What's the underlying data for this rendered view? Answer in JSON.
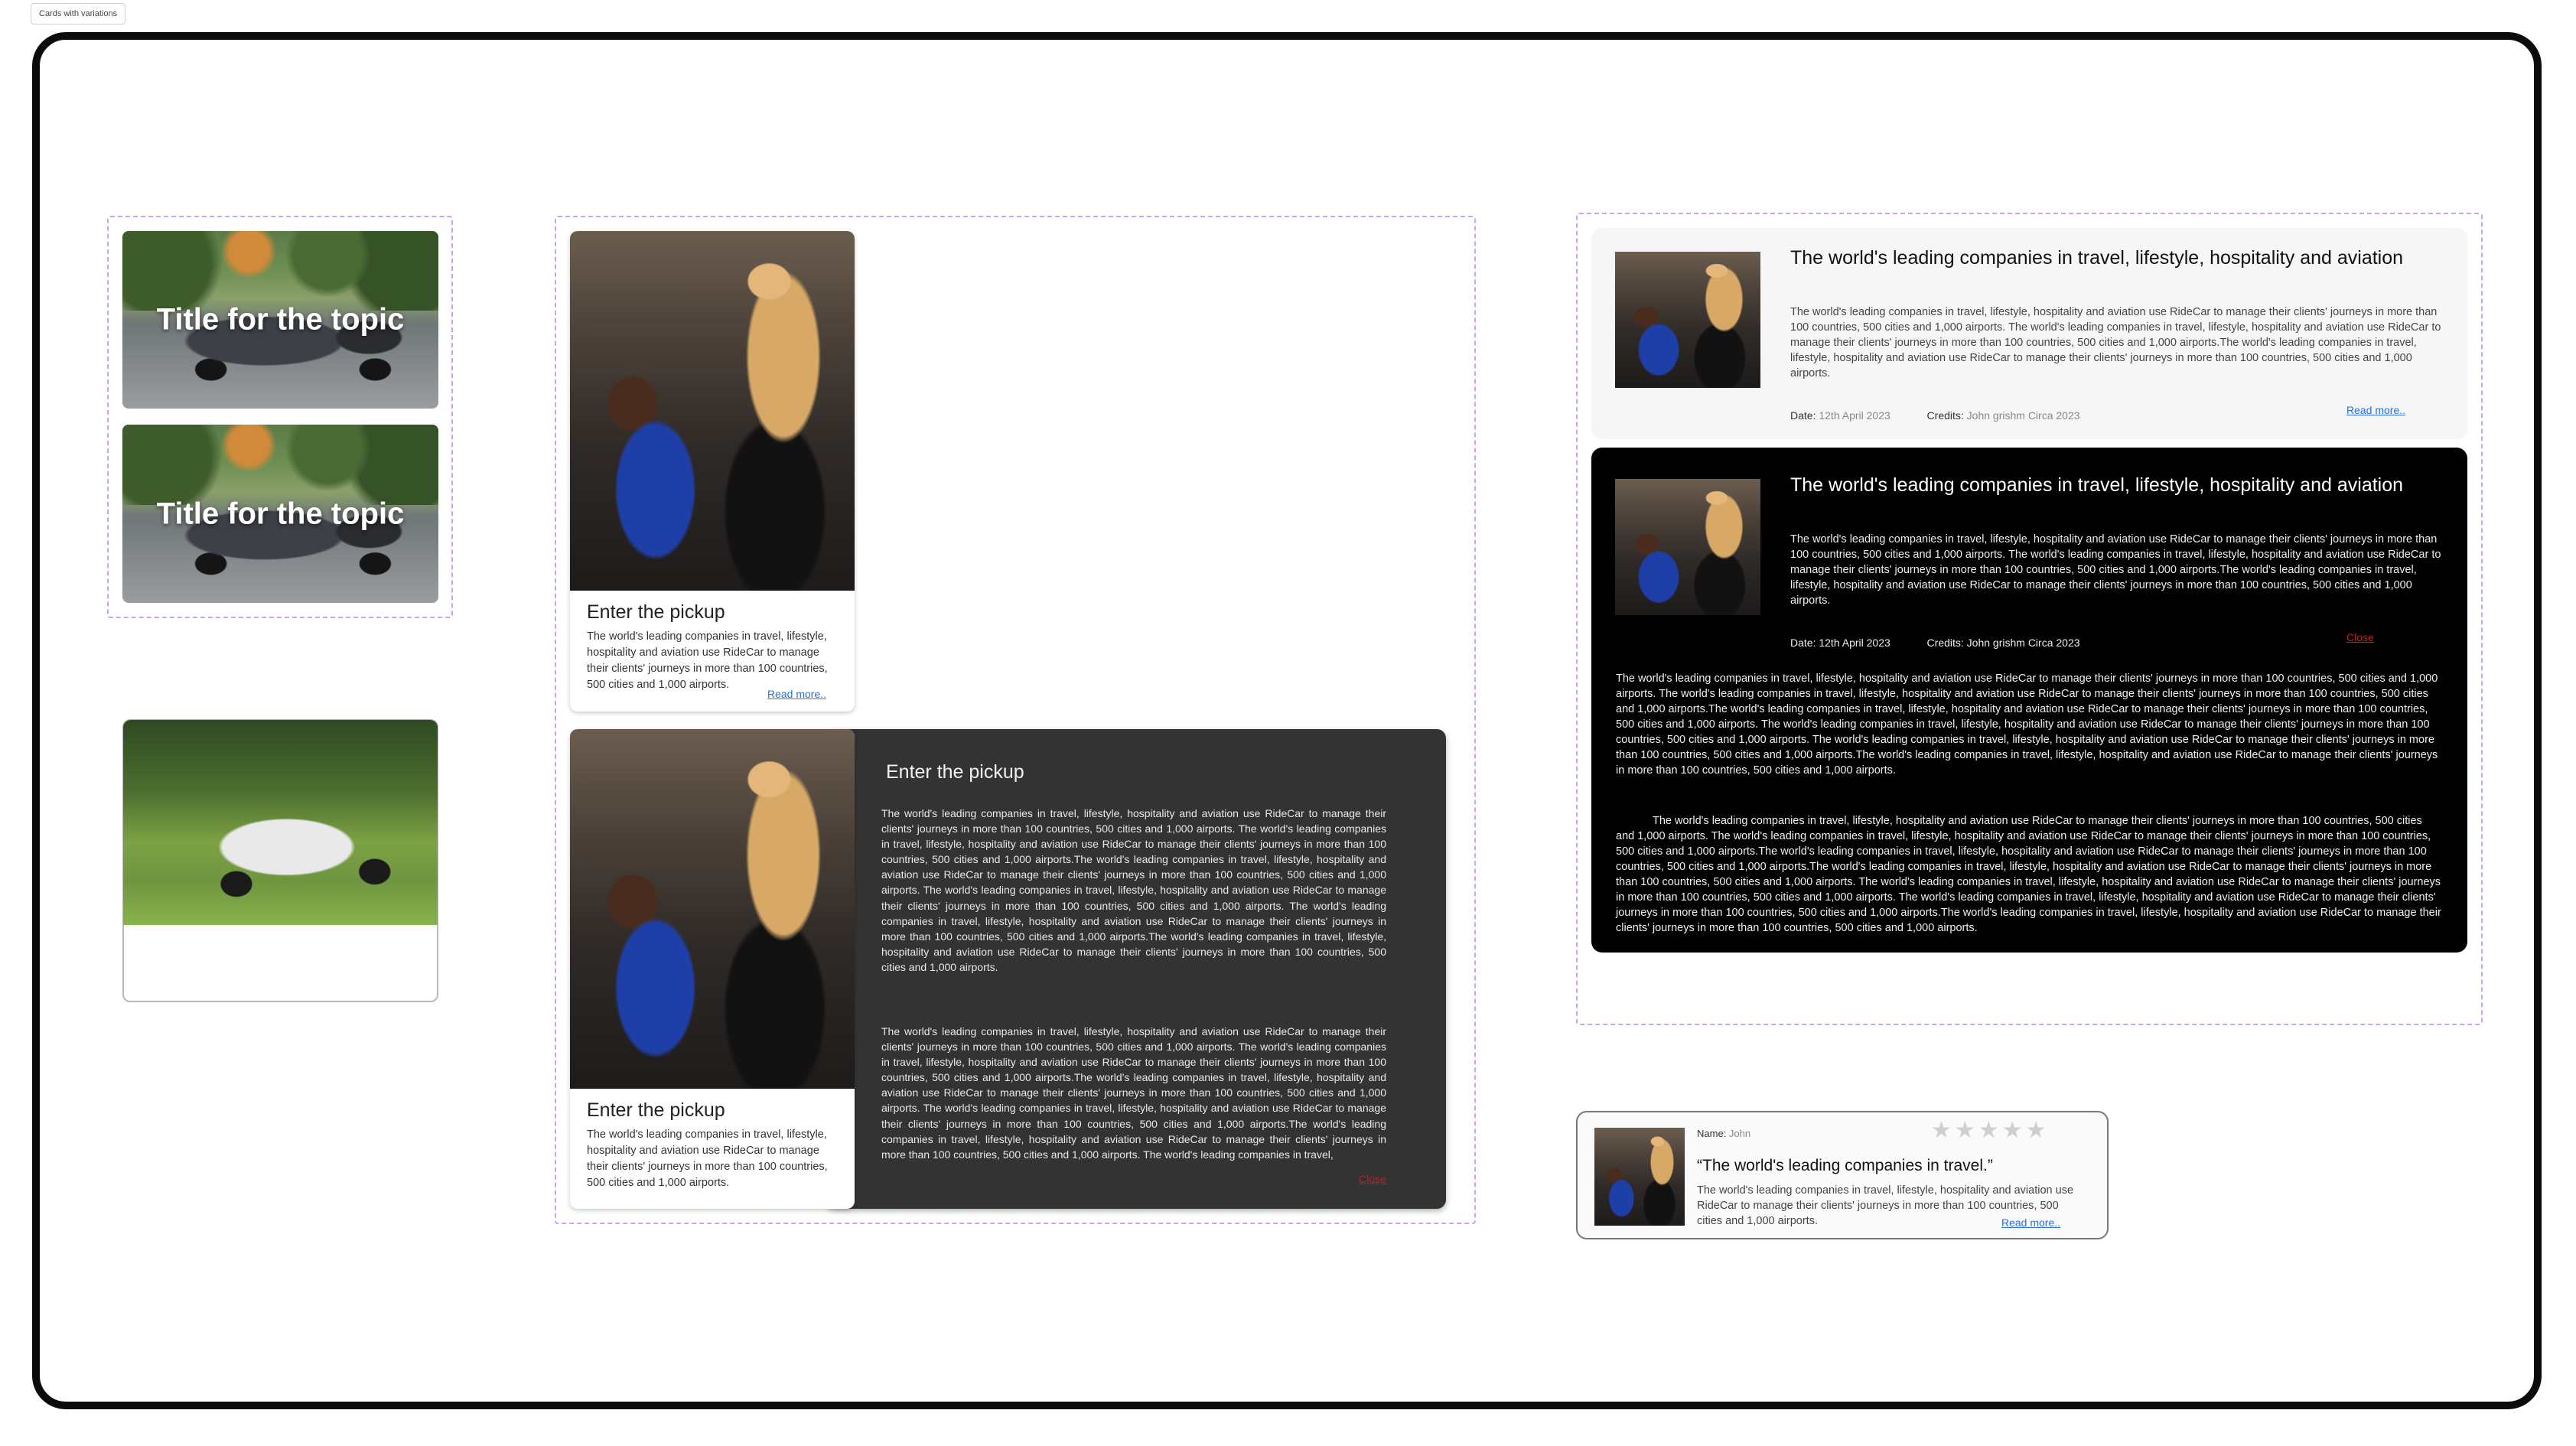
{
  "page_tag": "Cards with variations",
  "image_cards": [
    {
      "title": "Title for the topic"
    },
    {
      "title": "Title for the topic"
    }
  ],
  "pickup_card": {
    "title": "Enter the pickup",
    "body": "The world's leading companies in travel, lifestyle, hospitality and aviation use RideCar to manage their clients' journeys in more than 100 countries, 500 cities and 1,000 airports.",
    "read_more": "Read more.."
  },
  "pickup_card_expanded": {
    "title": "Enter the pickup",
    "body": "The world's leading companies in travel, lifestyle, hospitality and aviation use RideCar to manage their clients' journeys in more than 100 countries, 500 cities and 1,000 airports.",
    "panel_title": "Enter the pickup",
    "panel_para1": "The world's leading companies in travel, lifestyle, hospitality and aviation use RideCar to manage their clients' journeys in more than 100 countries, 500 cities and 1,000 airports. The world's leading companies in travel, lifestyle, hospitality and aviation use RideCar to manage their clients' journeys in more than 100 countries, 500 cities and 1,000 airports.The world's leading companies in travel, lifestyle, hospitality and aviation use RideCar to manage their clients' journeys in more than 100 countries, 500 cities and 1,000 airports. The world's leading companies in travel, lifestyle, hospitality and aviation use RideCar to manage their clients' journeys in more than 100 countries, 500 cities and 1,000 airports. The world's leading companies in travel, lifestyle, hospitality and aviation use RideCar to manage their clients' journeys in more than 100 countries, 500 cities and 1,000 airports.The world's leading companies in travel, lifestyle, hospitality and aviation use RideCar to manage their clients' journeys in more than 100 countries, 500 cities and 1,000 airports.",
    "panel_para2": "The world's leading companies in travel, lifestyle, hospitality and aviation use RideCar to manage their clients' journeys in more than 100 countries, 500 cities and 1,000 airports. The world's leading companies in travel, lifestyle, hospitality and aviation use RideCar to manage their clients' journeys in more than 100 countries, 500 cities and 1,000 airports.The world's leading companies in travel, lifestyle, hospitality and aviation use RideCar to manage their clients' journeys in more than 100 countries, 500 cities and 1,000 airports. The world's leading companies in travel, lifestyle, hospitality and aviation use RideCar to manage their clients' journeys in more than 100 countries, 500 cities and 1,000 airports.The world's leading companies in travel, lifestyle, hospitality and aviation use RideCar to manage their clients' journeys in more than 100 countries, 500 cities and 1,000 airports. The world's leading companies in travel,",
    "close": "Close"
  },
  "article_light": {
    "title": "The world's leading companies in travel, lifestyle, hospitality and aviation",
    "body": "The world's leading companies in travel, lifestyle, hospitality and aviation use RideCar to manage their clients' journeys in more than 100 countries, 500 cities and 1,000 airports. The world's leading companies in travel, lifestyle, hospitality and aviation use RideCar to manage their clients' journeys in more than 100 countries, 500 cities and 1,000 airports.The world's leading companies in travel, lifestyle, hospitality and aviation use RideCar to manage their clients' journeys in more than 100 countries, 500 cities and 1,000 airports.",
    "date_label": "Date:",
    "date_value": "12th April 2023",
    "credits_label": "Credits:",
    "credits_value": "John grishm  Circa 2023",
    "read_more": "Read more.."
  },
  "article_dark": {
    "title": "The world's leading companies in travel, lifestyle, hospitality and aviation",
    "body": "The world's leading companies in travel, lifestyle, hospitality and aviation use RideCar to manage their clients' journeys in more than 100 countries, 500 cities and 1,000 airports. The world's leading companies in travel, lifestyle, hospitality and aviation use RideCar to manage their clients' journeys in more than 100 countries, 500 cities and 1,000 airports.The world's leading companies in travel, lifestyle, hospitality and aviation use RideCar to manage their clients' journeys in more than 100 countries, 500 cities and 1,000 airports.",
    "date_label": "Date:",
    "date_value": "12th April 2023",
    "credits_label": "Credits:",
    "credits_value": "John grishm  Circa 2023",
    "close": "Close",
    "long_para1": "The world's leading companies in travel, lifestyle, hospitality and aviation use RideCar to manage their clients' journeys in more than 100 countries, 500 cities and 1,000 airports. The world's leading companies in travel, lifestyle, hospitality and aviation use RideCar to manage their clients' journeys in more than 100 countries, 500 cities and 1,000 airports.The world's leading companies in travel, lifestyle, hospitality and aviation use RideCar to manage their clients' journeys in more than 100 countries, 500 cities and 1,000 airports. The world's leading companies in travel, lifestyle, hospitality and aviation use RideCar to manage their clients' journeys in more than 100 countries, 500 cities and 1,000 airports. The world's leading companies in travel, lifestyle, hospitality and aviation use RideCar to manage their clients' journeys in more than 100 countries, 500 cities and 1,000 airports.The world's leading companies in travel, lifestyle, hospitality and aviation use RideCar to manage their clients' journeys in more than 100 countries, 500 cities and 1,000 airports.",
    "long_para2": "The world's leading companies in travel, lifestyle, hospitality and aviation use RideCar to manage their clients' journeys in more than 100 countries, 500 cities and 1,000 airports. The world's leading companies in travel, lifestyle, hospitality and aviation use RideCar to manage their clients' journeys in more than 100 countries, 500 cities and 1,000 airports.The world's leading companies in travel, lifestyle, hospitality and aviation use RideCar to manage their clients' journeys in more than 100 countries, 500 cities and 1,000 airports.The world's leading companies in travel, lifestyle, hospitality and aviation use RideCar to manage their clients' journeys in more than 100 countries, 500 cities and 1,000 airports. The world's leading companies in travel, lifestyle, hospitality and aviation use RideCar to manage their clients' journeys in more than 100 countries, 500 cities and 1,000 airports. The world's leading companies in travel, lifestyle, hospitality and aviation use RideCar to manage their clients' journeys in more than 100 countries, 500 cities and 1,000 airports.The world's leading companies in travel, lifestyle, hospitality and aviation use RideCar to manage their clients' journeys in more than 100 countries, 500 cities and 1,000 airports."
  },
  "testimonial": {
    "name_label": "Name:",
    "name_value": "John",
    "rating": 0,
    "stars_total": 5,
    "quote": "“The world's leading companies in travel.”",
    "body": "The world's leading companies in travel, lifestyle, hospitality and aviation use RideCar to manage their clients' journeys in more than 100 countries, 500 cities and 1,000 airports.",
    "read_more": "Read more.."
  },
  "colors": {
    "frame": "#0b0b0b",
    "group_outline": "#c9a2f2",
    "link": "#2a6fd6",
    "close": "#d01a1a",
    "dark_panel": "#333333",
    "star_empty": "#cfcfcf"
  }
}
